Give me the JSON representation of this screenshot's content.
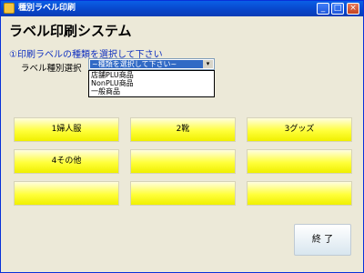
{
  "window": {
    "title": "種別ラベル印刷",
    "controls": {
      "minimize": "_",
      "maximize": "□",
      "close": "×"
    }
  },
  "heading": "ラベル印刷システム",
  "instruction": "①印刷ラベルの種類を選択して下さい",
  "selector": {
    "label": "ラベル種別選択",
    "value": "~種類を選択して下さい~",
    "arrow": "▾",
    "options": [
      "店舗PLU商品",
      "NonPLU商品",
      "一般商品"
    ]
  },
  "buttons": [
    "1婦人服",
    "2靴",
    "3グッズ",
    "4その他",
    "",
    "",
    "",
    "",
    ""
  ],
  "exit_button": "終 了",
  "colors": {
    "title_bar": "#0845c9",
    "button_yellow": "#ffff3a",
    "selection": "#316ac5",
    "instruction_text": "#1030c0"
  }
}
